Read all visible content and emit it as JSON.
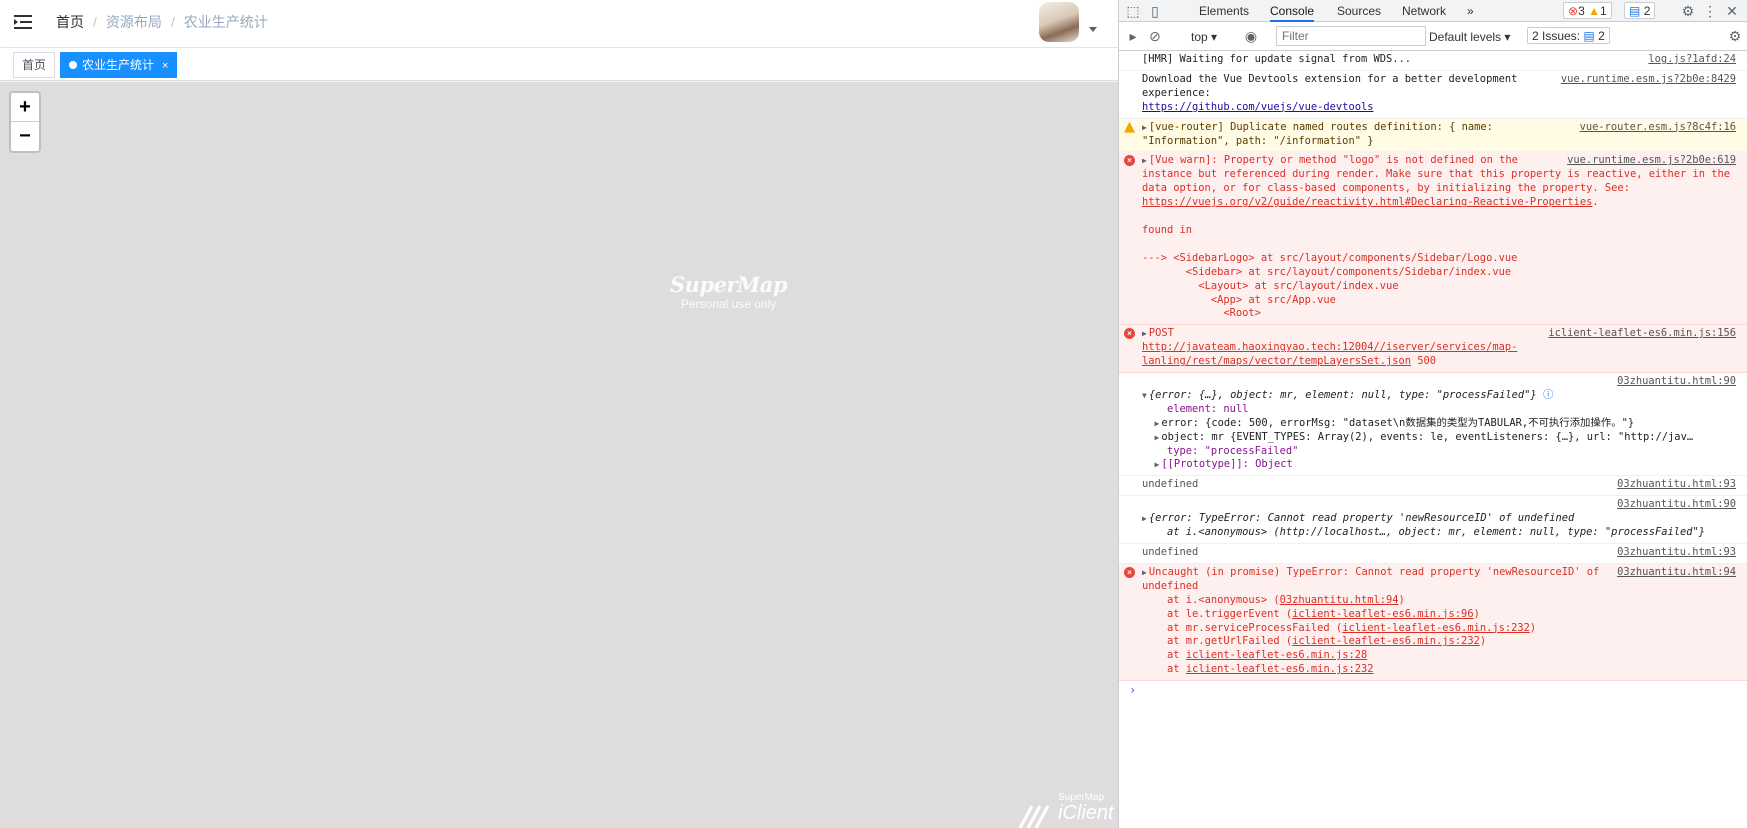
{
  "breadcrumb": {
    "home": "首页",
    "sep": "/",
    "level2": "资源布局",
    "level3": "农业生产统计"
  },
  "tags": {
    "home": "首页",
    "active": "农业生产统计",
    "close": "×"
  },
  "map": {
    "zoom_in": "+",
    "zoom_out": "−",
    "watermark_title": "SuperMap",
    "watermark_sub": "Personal use only",
    "brand_top": "SuperMap",
    "brand_main": "iClient"
  },
  "devtools": {
    "tabs": [
      "Elements",
      "Console",
      "Sources",
      "Network"
    ],
    "more": "»",
    "errors": "3",
    "warnings": "1",
    "infos": "2",
    "context": "top",
    "filter_placeholder": "Filter",
    "levels": "Default levels",
    "issues_label": "2 Issues:",
    "issues_count": "2"
  },
  "console": {
    "m1_text": "[HMR] Waiting for update signal from WDS...",
    "m1_src": "log.js?1afd:24",
    "m2_text": "Download the Vue Devtools extension for a better development experience:",
    "m2_link": "https://github.com/vuejs/vue-devtools",
    "m2_src": "vue.runtime.esm.js?2b0e:8429",
    "m3_text": "[vue-router] Duplicate named routes definition: { name: \"Information\", path: \"/information\" }",
    "m3_src": "vue-router.esm.js?8c4f:16",
    "m4_text": "[Vue warn]: Property or method \"logo\" is not defined on the instance but referenced during render. Make sure that this property is reactive, either in the data option, or for class-based components, by initializing the property. See: ",
    "m4_link": "https://vuejs.org/v2/guide/reactivity.html#Declaring-Reactive-Properties",
    "m4_end": ".",
    "m4_found": "found in",
    "m4_trace": "---> <SidebarLogo> at src/layout/components/Sidebar/Logo.vue\n       <Sidebar> at src/layout/components/Sidebar/index.vue\n         <Layout> at src/layout/index.vue\n           <App> at src/App.vue\n             <Root>",
    "m4_src": "vue.runtime.esm.js?2b0e:619",
    "m5_pre": "POST ",
    "m5_link": "http://javateam.haoxingyao.tech:12004//iserver/services/map-lanling/rest/maps/vector/tempLayersSet.json",
    "m5_code": " 500",
    "m5_src": "iclient-leaflet-es6.min.js:156",
    "m6_src": "03zhuantitu.html:90",
    "m6_head": "{error: {…}, object: mr, element: null, type: \"processFailed\"}",
    "m6_element": "element: null",
    "m6_error": "error: {code: 500, errorMsg: \"dataset\\n数据集的类型为TABULAR,不可执行添加操作。\"}",
    "m6_object": "object: mr {EVENT_TYPES: Array(2), events: le, eventListeners: {…}, url: \"http://jav…",
    "m6_type": "type: \"processFailed\"",
    "m6_proto": "[[Prototype]]: Object",
    "m7_text": "undefined",
    "m7_src": "03zhuantitu.html:93",
    "m8_src": "03zhuantitu.html:90",
    "m8_text": "{error: TypeError: Cannot read property 'newResourceID' of undefined\n    at i.<anonymous> (http://localhost…, object: mr, element: null, type: \"processFailed\"}",
    "m9_text": "undefined",
    "m9_src": "03zhuantitu.html:93",
    "m10_head": "Uncaught (in promise) TypeError: Cannot read property 'newResourceID' of undefined",
    "m10_src": "03zhuantitu.html:94",
    "m10_l1": "    at i.<anonymous> (",
    "m10_l1_link": "03zhuantitu.html:94",
    "m10_l1_end": ")",
    "m10_l2": "    at le.triggerEvent (",
    "m10_l2_link": "iclient-leaflet-es6.min.js:96",
    "m10_l2_end": ")",
    "m10_l3": "    at mr.serviceProcessFailed (",
    "m10_l3_link": "iclient-leaflet-es6.min.js:232",
    "m10_l3_end": ")",
    "m10_l4": "    at mr.getUrlFailed (",
    "m10_l4_link": "iclient-leaflet-es6.min.js:232",
    "m10_l4_end": ")",
    "m10_l5": "    at ",
    "m10_l5_link": "iclient-leaflet-es6.min.js:28",
    "m10_l6": "    at ",
    "m10_l6_link": "iclient-leaflet-es6.min.js:232",
    "prompt": "›"
  }
}
